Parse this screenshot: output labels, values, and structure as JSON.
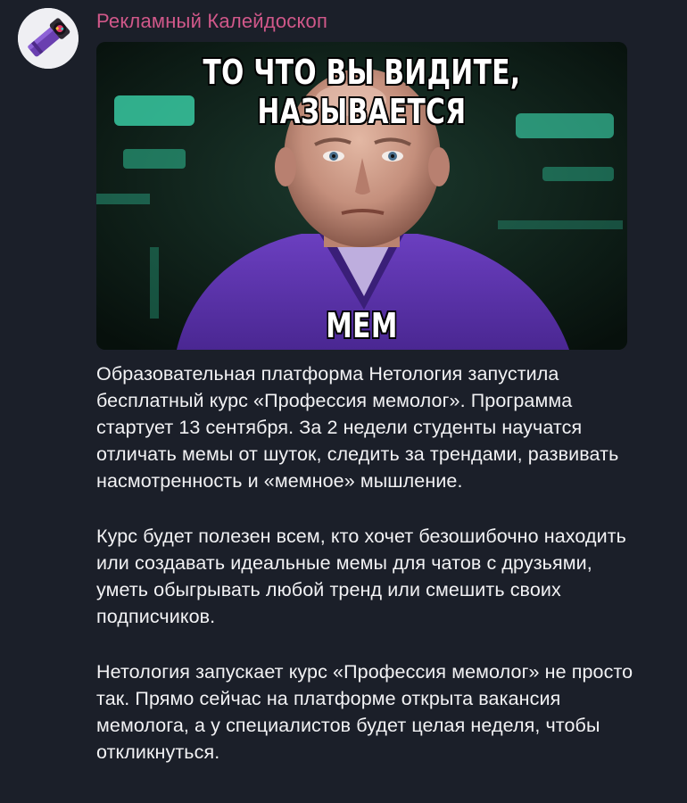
{
  "channel": {
    "name": "Рекламный Калейдоскоп",
    "avatar_icon": "kaleidoscope-icon",
    "name_color": "#d1588a"
  },
  "media": {
    "top_caption": "ТО ЧТО ВЫ ВИДИТЕ, НАЗЫВАЕТСЯ",
    "bottom_caption": "МЕМ"
  },
  "post": {
    "paragraphs": [
      "Образовательная платформа Нетология запустила бесплатный курс «Профессия мемолог». Программа стартует 13 сентября. За 2 недели студенты научатся отличать мемы от шуток, следить за трендами, развивать насмотренность и «мемное» мышление.",
      "Курс будет полезен всем, кто хочет безошибочно находить или создавать идеальные мемы для чатов с друзьями, уметь обыгрывать любой тренд или смешить своих подписчиков.",
      "Нетология запускает курс «Профессия мемолог» не просто так. Прямо сейчас на платформе открыта вакансия мемолога, а у специалистов будет целая неделя, чтобы откликнуться."
    ]
  },
  "colors": {
    "background": "#1b1f29",
    "text": "#f2f2f4"
  }
}
